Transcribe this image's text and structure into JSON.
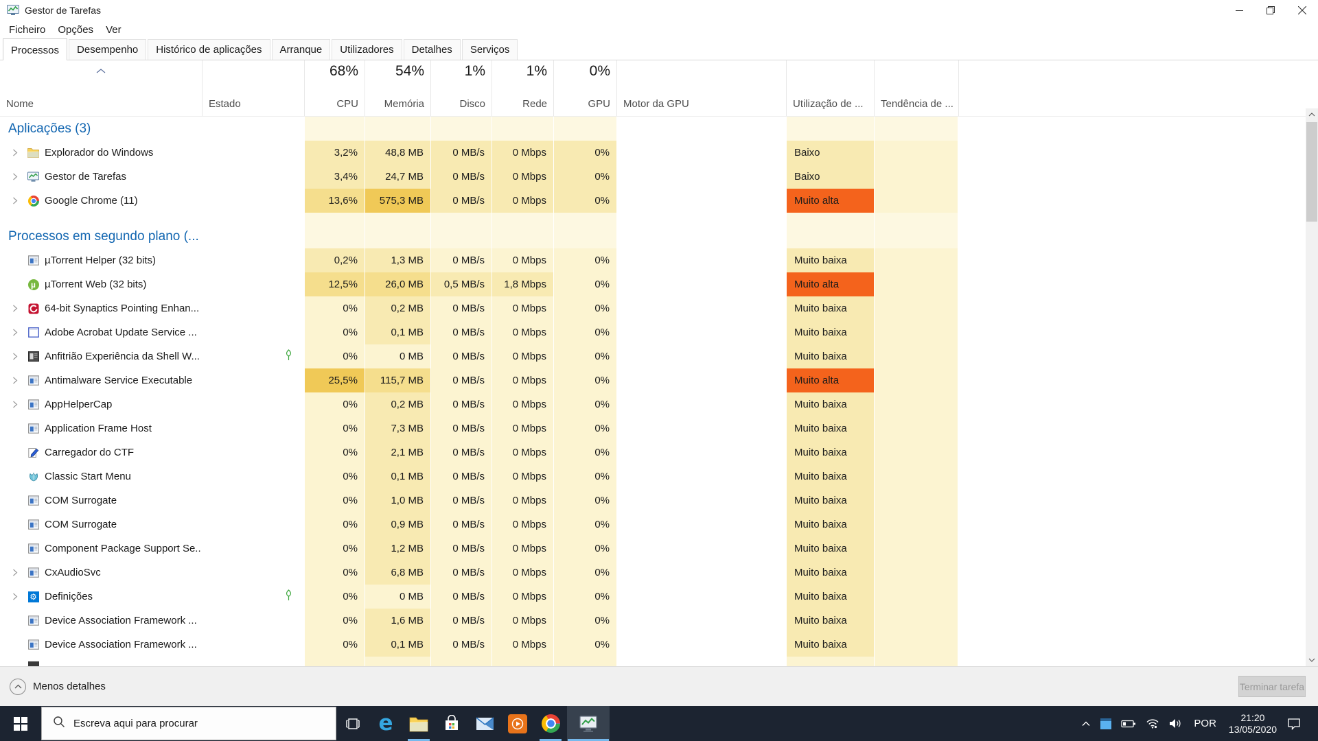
{
  "window": {
    "title": "Gestor de Tarefas"
  },
  "menu": [
    "Ficheiro",
    "Opções",
    "Ver"
  ],
  "tabs": [
    {
      "label": "Processos",
      "selected": true
    },
    {
      "label": "Desempenho",
      "selected": false
    },
    {
      "label": "Histórico de aplicações",
      "selected": false
    },
    {
      "label": "Arranque",
      "selected": false
    },
    {
      "label": "Utilizadores",
      "selected": false
    },
    {
      "label": "Detalhes",
      "selected": false
    },
    {
      "label": "Serviços",
      "selected": false
    }
  ],
  "table": {
    "columns": {
      "nome": "Nome",
      "estado": "Estado",
      "cpu": "CPU",
      "memoria": "Memória",
      "disco": "Disco",
      "rede": "Rede",
      "gpu": "GPU",
      "motor": "Motor da GPU",
      "utilizacao": "Utilização de ...",
      "tendencia": "Tendência de ..."
    },
    "totals": {
      "cpu": "68%",
      "memoria": "54%",
      "disco": "1%",
      "rede": "1%",
      "gpu": "0%"
    },
    "rows": [
      {
        "type": "section",
        "label": "Aplicações (3)"
      },
      {
        "type": "process",
        "name": "Explorador do Windows",
        "icon": "explorer",
        "chevron": true,
        "leaf": false,
        "cpu": "3,2%",
        "mem": "48,8 MB",
        "disk": "0 MB/s",
        "net": "0 Mbps",
        "gpu": "0%",
        "util": "Baixo",
        "heat": [
          1,
          1,
          1,
          1,
          1
        ],
        "util_heat": 1
      },
      {
        "type": "process",
        "name": "Gestor de Tarefas",
        "icon": "taskmgr",
        "chevron": true,
        "leaf": false,
        "cpu": "3,4%",
        "mem": "24,7 MB",
        "disk": "0 MB/s",
        "net": "0 Mbps",
        "gpu": "0%",
        "util": "Baixo",
        "heat": [
          1,
          1,
          1,
          1,
          1
        ],
        "util_heat": 1
      },
      {
        "type": "process",
        "name": "Google Chrome (11)",
        "icon": "chrome",
        "chevron": true,
        "leaf": false,
        "cpu": "13,6%",
        "mem": "575,3 MB",
        "disk": "0 MB/s",
        "net": "0 Mbps",
        "gpu": "0%",
        "util": "Muito alta",
        "heat": [
          2,
          3,
          1,
          1,
          1
        ],
        "util_heat": 4
      },
      {
        "type": "spacer"
      },
      {
        "type": "section",
        "label": "Processos em segundo plano (..."
      },
      {
        "type": "process",
        "name": "µTorrent Helper (32 bits)",
        "icon": "generic",
        "chevron": false,
        "leaf": false,
        "cpu": "0,2%",
        "mem": "1,3 MB",
        "disk": "0 MB/s",
        "net": "0 Mbps",
        "gpu": "0%",
        "util": "Muito baixa",
        "heat": [
          1,
          1,
          0,
          0,
          0
        ],
        "util_heat": 1
      },
      {
        "type": "process",
        "name": "µTorrent Web (32 bits)",
        "icon": "utorrent",
        "chevron": false,
        "leaf": false,
        "cpu": "12,5%",
        "mem": "26,0 MB",
        "disk": "0,5 MB/s",
        "net": "1,8 Mbps",
        "gpu": "0%",
        "util": "Muito alta",
        "heat": [
          2,
          2,
          1,
          1,
          0
        ],
        "util_heat": 4
      },
      {
        "type": "process",
        "name": "64-bit Synaptics Pointing Enhan...",
        "icon": "synaptics",
        "chevron": true,
        "leaf": false,
        "cpu": "0%",
        "mem": "0,2 MB",
        "disk": "0 MB/s",
        "net": "0 Mbps",
        "gpu": "0%",
        "util": "Muito baixa",
        "heat": [
          0,
          1,
          0,
          0,
          0
        ],
        "util_heat": 1
      },
      {
        "type": "process",
        "name": "Adobe Acrobat Update Service ...",
        "icon": "adobe",
        "chevron": true,
        "leaf": false,
        "cpu": "0%",
        "mem": "0,1 MB",
        "disk": "0 MB/s",
        "net": "0 Mbps",
        "gpu": "0%",
        "util": "Muito baixa",
        "heat": [
          0,
          1,
          0,
          0,
          0
        ],
        "util_heat": 1
      },
      {
        "type": "process",
        "name": "Anfitrião Experiência da Shell W...",
        "icon": "shell-dark",
        "chevron": true,
        "leaf": true,
        "cpu": "0%",
        "mem": "0 MB",
        "disk": "0 MB/s",
        "net": "0 Mbps",
        "gpu": "0%",
        "util": "Muito baixa",
        "heat": [
          0,
          0,
          0,
          0,
          0
        ],
        "util_heat": 1
      },
      {
        "type": "process",
        "name": "Antimalware Service Executable",
        "icon": "generic",
        "chevron": true,
        "leaf": false,
        "cpu": "25,5%",
        "mem": "115,7 MB",
        "disk": "0 MB/s",
        "net": "0 Mbps",
        "gpu": "0%",
        "util": "Muito alta",
        "heat": [
          3,
          2,
          0,
          0,
          0
        ],
        "util_heat": 4
      },
      {
        "type": "process",
        "name": "AppHelperCap",
        "icon": "generic",
        "chevron": true,
        "leaf": false,
        "cpu": "0%",
        "mem": "0,2 MB",
        "disk": "0 MB/s",
        "net": "0 Mbps",
        "gpu": "0%",
        "util": "Muito baixa",
        "heat": [
          0,
          1,
          0,
          0,
          0
        ],
        "util_heat": 1
      },
      {
        "type": "process",
        "name": "Application Frame Host",
        "icon": "generic",
        "chevron": false,
        "leaf": false,
        "cpu": "0%",
        "mem": "7,3 MB",
        "disk": "0 MB/s",
        "net": "0 Mbps",
        "gpu": "0%",
        "util": "Muito baixa",
        "heat": [
          0,
          1,
          0,
          0,
          0
        ],
        "util_heat": 1
      },
      {
        "type": "process",
        "name": "Carregador do CTF",
        "icon": "ctf",
        "chevron": false,
        "leaf": false,
        "cpu": "0%",
        "mem": "2,1 MB",
        "disk": "0 MB/s",
        "net": "0 Mbps",
        "gpu": "0%",
        "util": "Muito baixa",
        "heat": [
          0,
          1,
          0,
          0,
          0
        ],
        "util_heat": 1
      },
      {
        "type": "process",
        "name": "Classic Start Menu",
        "icon": "shell-classic",
        "chevron": false,
        "leaf": false,
        "cpu": "0%",
        "mem": "0,1 MB",
        "disk": "0 MB/s",
        "net": "0 Mbps",
        "gpu": "0%",
        "util": "Muito baixa",
        "heat": [
          0,
          1,
          0,
          0,
          0
        ],
        "util_heat": 1
      },
      {
        "type": "process",
        "name": "COM Surrogate",
        "icon": "generic",
        "chevron": false,
        "leaf": false,
        "cpu": "0%",
        "mem": "1,0 MB",
        "disk": "0 MB/s",
        "net": "0 Mbps",
        "gpu": "0%",
        "util": "Muito baixa",
        "heat": [
          0,
          1,
          0,
          0,
          0
        ],
        "util_heat": 1
      },
      {
        "type": "process",
        "name": "COM Surrogate",
        "icon": "generic",
        "chevron": false,
        "leaf": false,
        "cpu": "0%",
        "mem": "0,9 MB",
        "disk": "0 MB/s",
        "net": "0 Mbps",
        "gpu": "0%",
        "util": "Muito baixa",
        "heat": [
          0,
          1,
          0,
          0,
          0
        ],
        "util_heat": 1
      },
      {
        "type": "process",
        "name": "Component Package Support Se...",
        "icon": "generic",
        "chevron": false,
        "leaf": false,
        "cpu": "0%",
        "mem": "1,2 MB",
        "disk": "0 MB/s",
        "net": "0 Mbps",
        "gpu": "0%",
        "util": "Muito baixa",
        "heat": [
          0,
          1,
          0,
          0,
          0
        ],
        "util_heat": 1
      },
      {
        "type": "process",
        "name": "CxAudioSvc",
        "icon": "generic",
        "chevron": true,
        "leaf": false,
        "cpu": "0%",
        "mem": "6,8 MB",
        "disk": "0 MB/s",
        "net": "0 Mbps",
        "gpu": "0%",
        "util": "Muito baixa",
        "heat": [
          0,
          1,
          0,
          0,
          0
        ],
        "util_heat": 1
      },
      {
        "type": "process",
        "name": "Definições",
        "icon": "settings",
        "chevron": true,
        "leaf": true,
        "cpu": "0%",
        "mem": "0 MB",
        "disk": "0 MB/s",
        "net": "0 Mbps",
        "gpu": "0%",
        "util": "Muito baixa",
        "heat": [
          0,
          0,
          0,
          0,
          0
        ],
        "util_heat": 1
      },
      {
        "type": "process",
        "name": "Device Association Framework ...",
        "icon": "generic",
        "chevron": false,
        "leaf": false,
        "cpu": "0%",
        "mem": "1,6 MB",
        "disk": "0 MB/s",
        "net": "0 Mbps",
        "gpu": "0%",
        "util": "Muito baixa",
        "heat": [
          0,
          1,
          0,
          0,
          0
        ],
        "util_heat": 1
      },
      {
        "type": "process",
        "name": "Device Association Framework ...",
        "icon": "generic",
        "chevron": false,
        "leaf": false,
        "cpu": "0%",
        "mem": "0,1 MB",
        "disk": "0 MB/s",
        "net": "0 Mbps",
        "gpu": "0%",
        "util": "Muito baixa",
        "heat": [
          0,
          1,
          0,
          0,
          0
        ],
        "util_heat": 1
      },
      {
        "type": "partial",
        "icon": "dark"
      }
    ]
  },
  "footer": {
    "toggle": "Menos detalhes",
    "end_task": "Terminar tarefa"
  },
  "taskbar": {
    "search_placeholder": "Escreva aqui para procurar",
    "tray": {
      "lang": "POR",
      "time": "21:20",
      "date": "13/05/2020"
    }
  },
  "colors": {
    "heat0": "#fcf4d1",
    "heat1": "#f8eab2",
    "heat2": "#f5de8d",
    "heat3": "#f0c957",
    "heat4": "#f4631c",
    "heat_header": "#fdf8e1",
    "section_blue": "#1266b1",
    "taskbar_bg": "#1c2431",
    "run_indicator": "#76b9ed"
  }
}
